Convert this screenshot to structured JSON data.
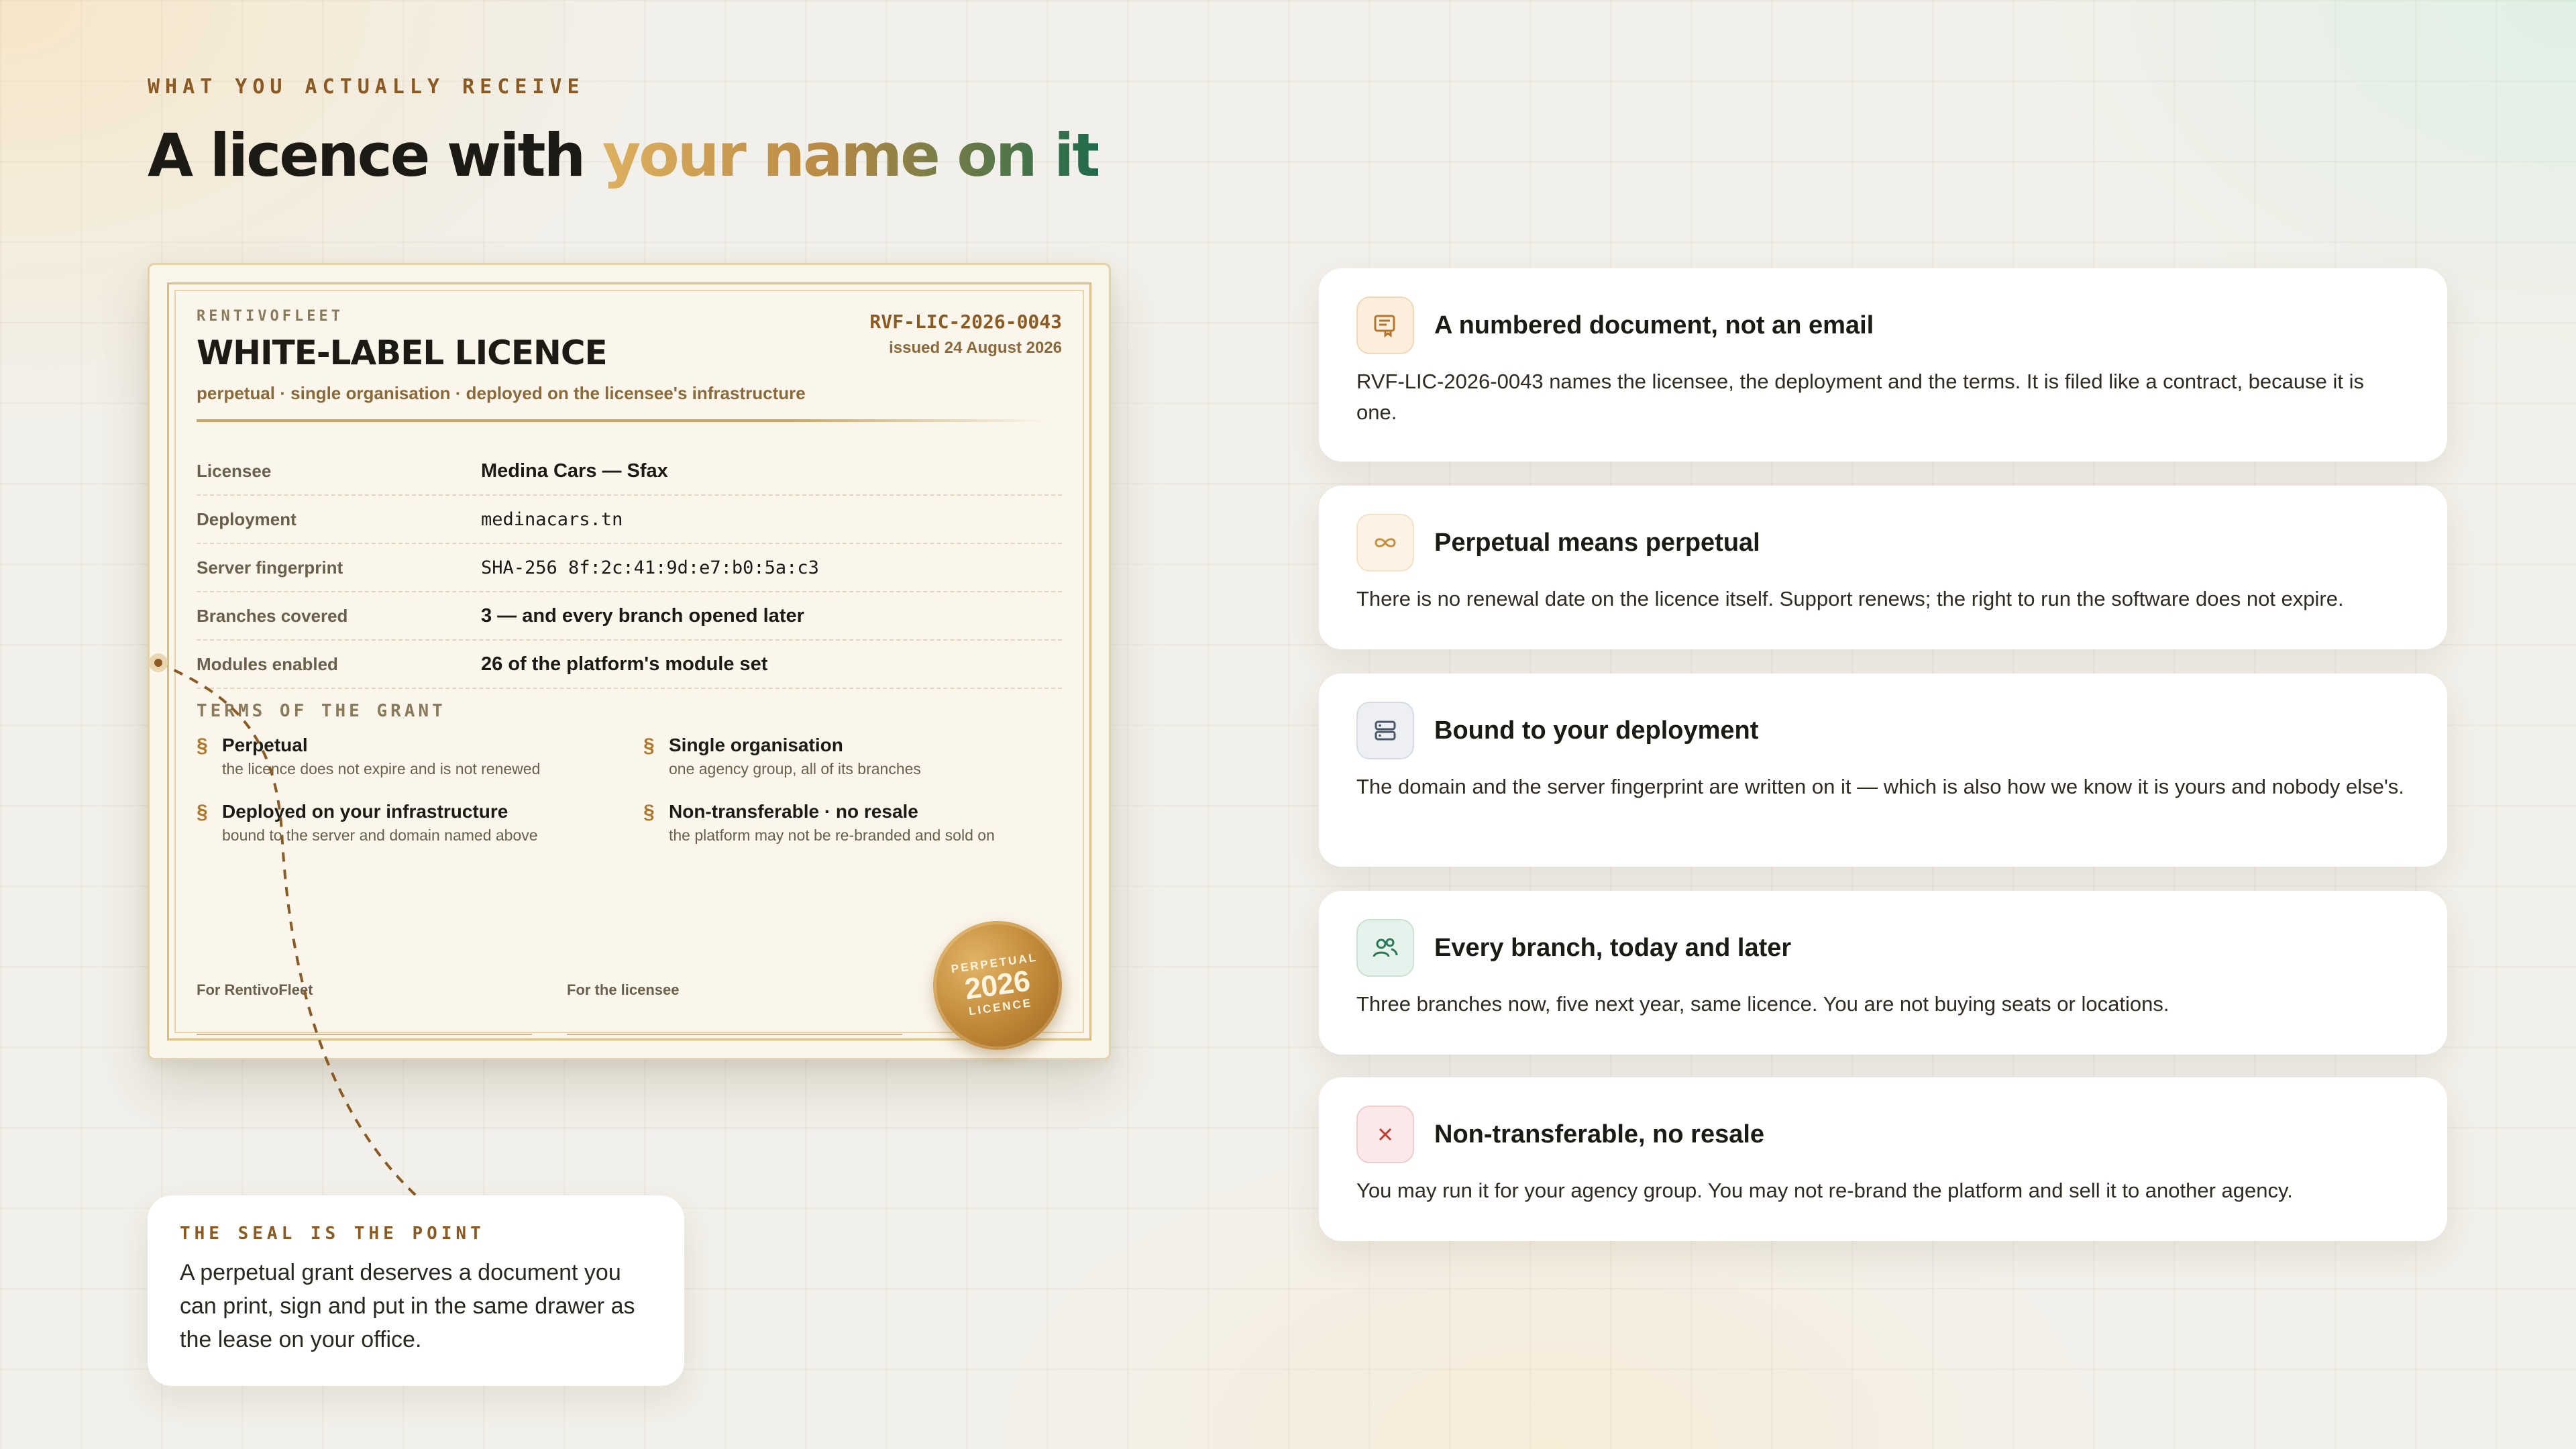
{
  "section": {
    "eyebrow": "WHAT YOU ACTUALLY RECEIVE",
    "headline_plain": "A licence with ",
    "headline_accent": "your name on it"
  },
  "certificate": {
    "brand": "RENTIVOFLEET",
    "title": "WHITE-LABEL LICENCE",
    "subtitle": "perpetual · single organisation · deployed on the licensee's infrastructure",
    "number": "RVF-LIC-2026-0043",
    "issued": "issued 24 August 2026",
    "fields": [
      {
        "label": "Licensee",
        "value": "Medina Cars — Sfax"
      },
      {
        "label": "Deployment",
        "value": "medinacars.tn"
      },
      {
        "label": "Server fingerprint",
        "value": "SHA-256 8f:2c:41:9d:e7:b0:5a:c3"
      },
      {
        "label": "Branches covered",
        "value": "3 — and every branch opened later"
      },
      {
        "label": "Modules enabled",
        "value": "26 of the platform's module set"
      }
    ],
    "terms_heading": "TERMS OF THE GRANT",
    "terms": [
      {
        "symbol": "§",
        "title": "Perpetual",
        "desc": "the licence does not expire and is not renewed"
      },
      {
        "symbol": "§",
        "title": "Single organisation",
        "desc": "one agency group, all of its branches"
      },
      {
        "symbol": "§",
        "title": "Deployed on your infrastructure",
        "desc": "bound to the server and domain named above"
      },
      {
        "symbol": "§",
        "title": "Non-transferable · no resale",
        "desc": "the platform may not be re-branded and sold on"
      }
    ],
    "sign_rentivo": "For RentivoFleet",
    "sign_licensee": "For the licensee",
    "seal": {
      "top": "PERPETUAL",
      "year": "2026",
      "bottom": "LICENCE"
    }
  },
  "callout": {
    "eyebrow": "THE SEAL IS THE POINT",
    "text": "A perpetual grant deserves a document you can print, sign and put in the same drawer as the lease on your office."
  },
  "features": [
    {
      "icon": "document-icon",
      "title": "A numbered document, not an email",
      "text": "RVF-LIC-2026-0043 names the licensee, the deployment and the terms. It is filed like a contract, because it is one."
    },
    {
      "icon": "infinity-icon",
      "title": "Perpetual means perpetual",
      "text": "There is no renewal date on the licence itself. Support renews; the right to run the software does not expire."
    },
    {
      "icon": "server-icon",
      "title": "Bound to your deployment",
      "text": "The domain and the server fingerprint are written on it — which is also how we know it is yours and nobody else's."
    },
    {
      "icon": "users-icon",
      "title": "Every branch, today and later",
      "text": "Three branches now, five next year, same licence. You are not buying seats or locations."
    },
    {
      "icon": "close-icon",
      "title": "Non-transferable, no resale",
      "text": "You may run it for your agency group. You may not re-brand the platform and sell it to another agency."
    }
  ],
  "colors": {
    "accent_brown": "#8a5a22",
    "accent_gold": "#c18a3a",
    "accent_green": "#1f6b4c",
    "danger": "#c0392b"
  }
}
